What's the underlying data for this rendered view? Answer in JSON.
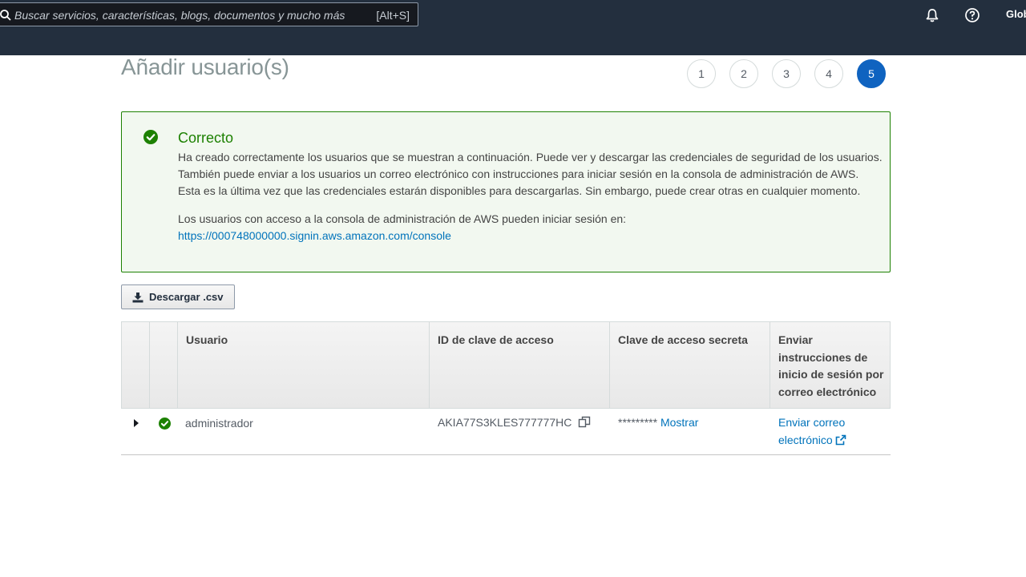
{
  "header": {
    "search_placeholder": "Buscar servicios, características, blogs, documentos y mucho más",
    "search_shortcut": "[Alt+S]",
    "region_label": "Glob",
    "icons": [
      "search-icon",
      "bell-icon",
      "help-icon"
    ]
  },
  "page": {
    "title": "Añadir usuario(s)",
    "steps": [
      "1",
      "2",
      "3",
      "4",
      "5"
    ],
    "active_step": "5"
  },
  "alert": {
    "title": "Correcto",
    "lines": [
      "Ha creado correctamente los usuarios que se muestran a continuación. Puede ver y descargar las credenciales de seguridad de los usuarios.",
      "También puede enviar a los usuarios un correo electrónico con instrucciones para iniciar sesión en la consola de administración de AWS.",
      "Esta es la última vez que las credenciales estarán disponibles para descargarlas. Sin embargo, puede crear otras en cualquier momento."
    ],
    "login_text": "Los usuarios con acceso a la consola de administración de AWS pueden iniciar sesión en:",
    "login_url": "https://000748000000.signin.aws.amazon.com/console"
  },
  "download_button": "Descargar .csv",
  "table": {
    "headers": {
      "user": "Usuario",
      "access_key_id": "ID de clave de acceso",
      "secret_key": "Clave de acceso secreta",
      "send_instructions": "Enviar instrucciones de inicio de sesión por correo electrónico"
    },
    "rows": [
      {
        "user": "administrador",
        "access_key_id": "AKIA77S3KLES777777HC",
        "secret_masked": "*********",
        "show_label": "Mostrar",
        "email_label_1": "Enviar correo",
        "email_label_2": "electrónico"
      }
    ]
  },
  "colors": {
    "nav_bg": "#232f3e",
    "success": "#1d8102",
    "link": "#0073bb",
    "active_step": "#0f63c0"
  }
}
